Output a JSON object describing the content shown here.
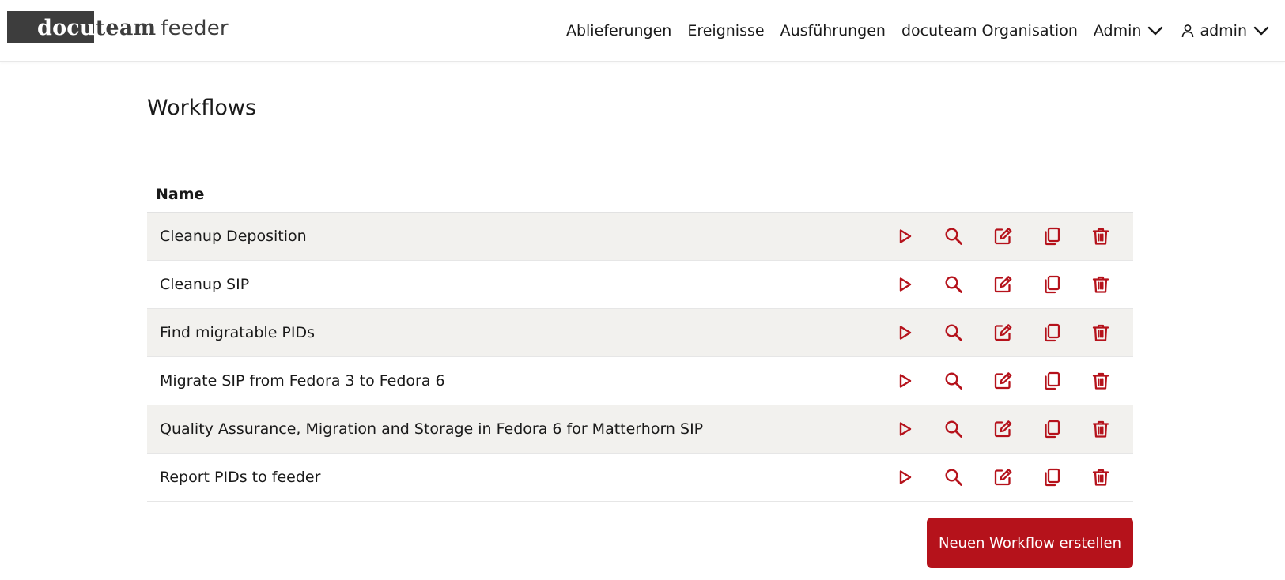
{
  "brand": {
    "word1": "docu",
    "word2": "team",
    "word3": "feeder"
  },
  "nav": {
    "items": [
      "Ablieferungen",
      "Ereignisse",
      "Ausführungen",
      "docuteam Organisation"
    ],
    "admin_menu": "Admin",
    "user_menu": "admin"
  },
  "page": {
    "title": "Workflows"
  },
  "table": {
    "header_name": "Name",
    "rows": [
      "Cleanup Deposition",
      "Cleanup SIP",
      "Find migratable PIDs",
      "Migrate SIP from Fedora 3 to Fedora 6",
      "Quality Assurance, Migration and Storage in Fedora 6 for Matterhorn SIP",
      "Report PIDs to feeder"
    ]
  },
  "actions": {
    "icons": [
      "play-icon",
      "search-icon",
      "edit-icon",
      "copy-icon",
      "trash-icon"
    ]
  },
  "buttons": {
    "new_workflow": "Neuen Workflow erstellen"
  },
  "colors": {
    "accent": "#b5121b",
    "logo_box": "#3d3d3d",
    "row_alt": "#f2f1ee"
  }
}
